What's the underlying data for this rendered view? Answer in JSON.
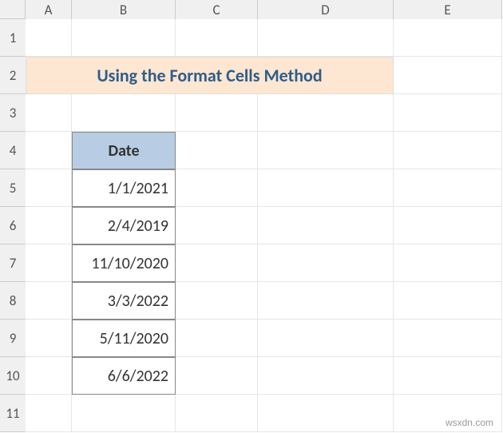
{
  "columns": [
    "A",
    "B",
    "C",
    "D",
    "E"
  ],
  "rows": [
    "1",
    "2",
    "3",
    "4",
    "5",
    "6",
    "7",
    "8",
    "9",
    "10",
    "11"
  ],
  "title": "Using the Format Cells Method",
  "table": {
    "header": "Date",
    "values": [
      "1/1/2021",
      "2/4/2019",
      "11/10/2020",
      "3/3/2022",
      "5/11/2020",
      "6/6/2022"
    ]
  },
  "watermark": "wsxdn.com",
  "chart_data": {
    "type": "table",
    "title": "Using the Format Cells Method",
    "columns": [
      "Date"
    ],
    "rows": [
      [
        "1/1/2021"
      ],
      [
        "2/4/2019"
      ],
      [
        "11/10/2020"
      ],
      [
        "3/3/2022"
      ],
      [
        "5/11/2020"
      ],
      [
        "6/6/2022"
      ]
    ]
  }
}
